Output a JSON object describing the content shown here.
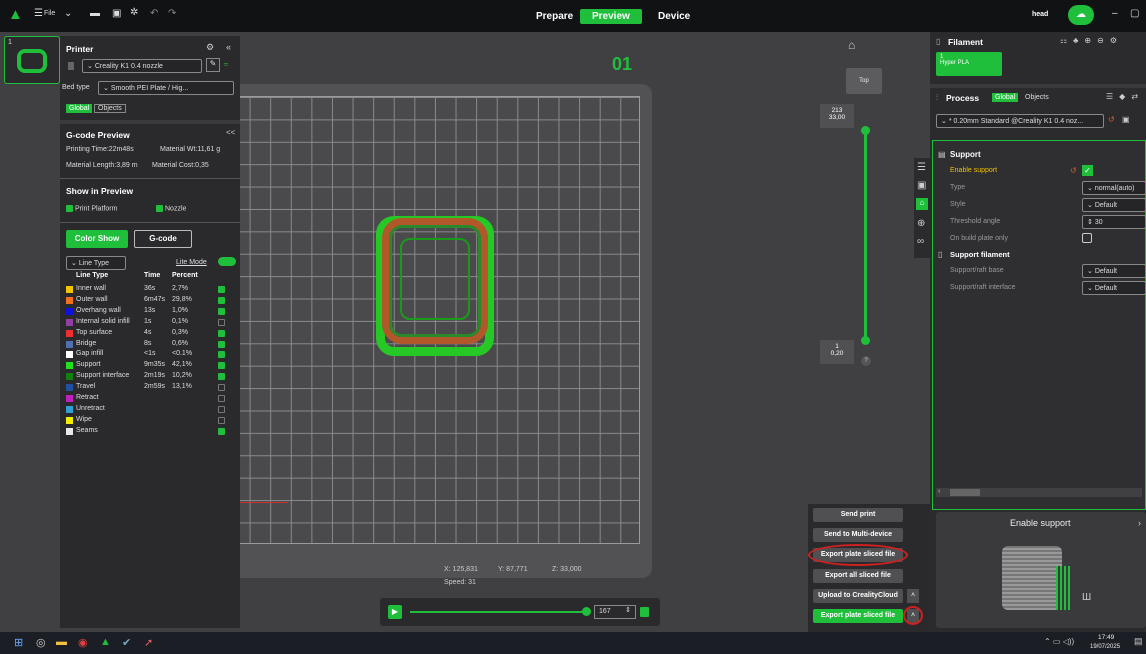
{
  "app": {
    "file_menu": "File",
    "tabs": [
      "Prepare",
      "Preview",
      "Device"
    ],
    "user": "head"
  },
  "plate": {
    "number": "01",
    "index": "1",
    "top_button": "Top"
  },
  "printer": {
    "title": "Printer",
    "nozzle": "Creality K1 0.4 nozzle",
    "bed_label": "Bed type",
    "bed_value": "Smooth PEI Plate / Hig...",
    "scope_global": "Global",
    "scope_objects": "Objects"
  },
  "gcode": {
    "title": "G-code Preview",
    "print_time": "Printing Time:22m48s",
    "material_wt": "Material Wt:11,61 g",
    "material_len": "Material Length:3,89 m",
    "material_cost": "Material Cost:0,35"
  },
  "show": {
    "title": "Show in Preview",
    "platform": "Print Platform",
    "nozzle": "Nozzle",
    "color_show": "Color Show",
    "gcode_btn": "G-code",
    "line_type_select": "Line Type",
    "lite_mode": "Lite Mode"
  },
  "line_table": {
    "headers": [
      "Line Type",
      "Time",
      "Percent"
    ],
    "rows": [
      {
        "name": "Inner wall",
        "time": "36s",
        "pct": "2,7%",
        "color": "#f0c400",
        "checked": true
      },
      {
        "name": "Outer wall",
        "time": "6m47s",
        "pct": "29,8%",
        "color": "#f07020",
        "checked": true
      },
      {
        "name": "Overhang wall",
        "time": "13s",
        "pct": "1,0%",
        "color": "#1010e0",
        "checked": true
      },
      {
        "name": "Internal solid infill",
        "time": "1s",
        "pct": "0,1%",
        "color": "#9040a0",
        "checked": false
      },
      {
        "name": "Top surface",
        "time": "4s",
        "pct": "0,3%",
        "color": "#f03030",
        "checked": true
      },
      {
        "name": "Bridge",
        "time": "8s",
        "pct": "0,6%",
        "color": "#5070b0",
        "checked": true
      },
      {
        "name": "Gap infill",
        "time": "<1s",
        "pct": "<0.1%",
        "color": "#ffffff",
        "checked": true
      },
      {
        "name": "Support",
        "time": "9m35s",
        "pct": "42,1%",
        "color": "#20e020",
        "checked": true
      },
      {
        "name": "Support interface",
        "time": "2m19s",
        "pct": "10,2%",
        "color": "#108010",
        "checked": true
      },
      {
        "name": "Travel",
        "time": "2m59s",
        "pct": "13,1%",
        "color": "#2050a0",
        "checked": false
      },
      {
        "name": "Retract",
        "time": "",
        "pct": "",
        "color": "#c020c0",
        "checked": false
      },
      {
        "name": "Unretract",
        "time": "",
        "pct": "",
        "color": "#30a0d0",
        "checked": false
      },
      {
        "name": "Wipe",
        "time": "",
        "pct": "",
        "color": "#f0f000",
        "checked": false
      },
      {
        "name": "Seams",
        "time": "",
        "pct": "",
        "color": "#e8e8e8",
        "checked": true
      }
    ]
  },
  "slider": {
    "top_value": "213",
    "top_height": "33,00",
    "bottom_value": "1",
    "bottom_height": "0,20",
    "help": "?"
  },
  "status": {
    "x": "X: 125,831",
    "y": "Y: 87,771",
    "z": "Z: 33,000",
    "speed": "Speed: 31",
    "layer": "167"
  },
  "actions": {
    "send_print": "Send print",
    "send_multi": "Send to Multi-device",
    "export_plate": "Export plate sliced file",
    "export_all": "Export all sliced file",
    "upload": "Upload to CrealityCloud",
    "export_plate2": "Export plate sliced file"
  },
  "filament": {
    "title": "Filament",
    "slot": "1",
    "name": "Hyper PLA"
  },
  "process": {
    "title": "Process",
    "global": "Global",
    "objects": "Objects",
    "profile": "* 0.20mm Standard @Creality K1 0.4 noz..."
  },
  "support": {
    "title": "Support",
    "enable": "Enable support",
    "type_label": "Type",
    "type_value": "normal(auto)",
    "style_label": "Style",
    "style_value": "Default",
    "threshold_label": "Threshold angle",
    "threshold_value": "30",
    "build_plate_label": "On build plate only",
    "filament_title": "Support filament",
    "base_label": "Support/raft base",
    "base_value": "Default",
    "interface_label": "Support/raft interface",
    "interface_value": "Default"
  },
  "preview_card": {
    "title": "Enable support"
  },
  "taskbar": {
    "time": "17:49",
    "date": "19/07/2025"
  },
  "colors": {
    "accent": "#1fbf3c",
    "annotation": "#d02020"
  }
}
